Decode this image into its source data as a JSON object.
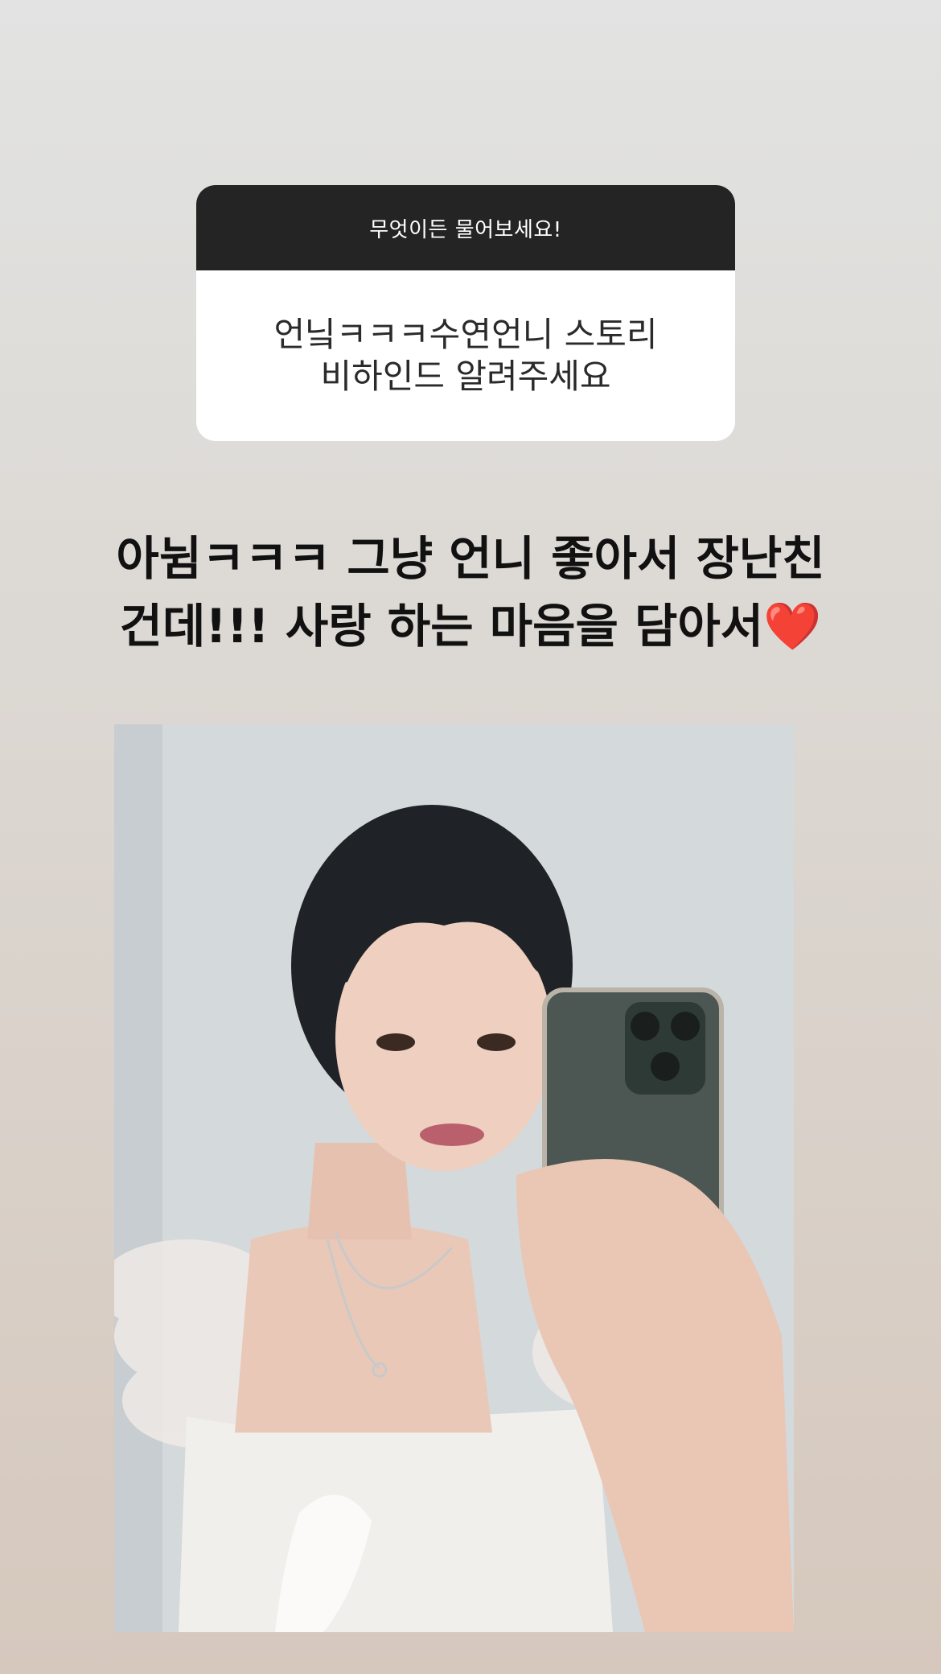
{
  "story": {
    "question_sticker": {
      "prompt": "무엇이든 물어보세요!",
      "question_lines": [
        "언닠ㅋㅋㅋ수연언니 스토리",
        "비하인드 알려주세요"
      ]
    },
    "reply": {
      "lines": [
        "아뉨ㅋㅋㅋ 그냥 언니 좋아서 장난친",
        "건데!!! 사랑 하는 마음을 담아서"
      ],
      "emoji": "❤️"
    },
    "photo": {
      "subject": "mirror-selfie"
    }
  }
}
